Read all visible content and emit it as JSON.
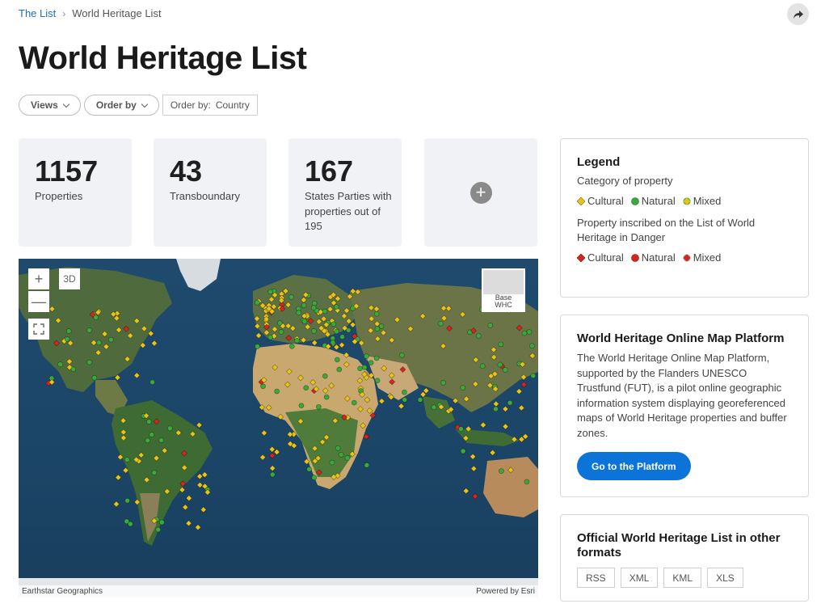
{
  "breadcrumb": {
    "home": "The List",
    "separator": "›",
    "current": "World Heritage List"
  },
  "share": {
    "icon": "share-icon"
  },
  "title": "World Heritage List",
  "filters": {
    "views_label": "Views",
    "order_label": "Order by",
    "order_prefix": "Order by:",
    "order_value": "Country"
  },
  "stats": [
    {
      "number": "1157",
      "label": "Properties"
    },
    {
      "number": "43",
      "label": "Transboundary"
    },
    {
      "number": "167",
      "label": "States Parties with properties out of 195"
    }
  ],
  "add_stat": {
    "symbol": "+",
    "icon": "plus-circle-icon"
  },
  "map": {
    "zoom_in": "+",
    "zoom_out": "—",
    "mode_3d": "3D",
    "expand_icon": "expand-icon",
    "basemap_label_line1": "Base",
    "basemap_label_line2": "WHC",
    "attribution_left": "Earthstar Geographics",
    "attribution_right": "Powered by Esri"
  },
  "legend": {
    "title": "Legend",
    "category_heading": "Category of property",
    "categories": [
      "Cultural",
      "Natural",
      "Mixed"
    ],
    "danger_heading": "Property inscribed on the List of World Heritage in Danger",
    "danger_categories": [
      "Cultural",
      "Natural",
      "Mixed"
    ]
  },
  "platform": {
    "title": "World Heritage Online Map Platform",
    "description": "The World Heritage Online Map Platform, supported by the Flanders UNESCO Trustfund (FUT), is a pilot online geographic information system displaying georeferenced maps of World Heritage properties and buffer zones.",
    "button": "Go to the Platform"
  },
  "formats": {
    "title": "Official World Heritage List in other formats",
    "items": [
      "RSS",
      "XML",
      "KML",
      "XLS"
    ]
  },
  "colors": {
    "accent": "#0c74d8",
    "cultural": "#e8c31a",
    "natural": "#3aa83a",
    "danger": "#d9231f"
  }
}
